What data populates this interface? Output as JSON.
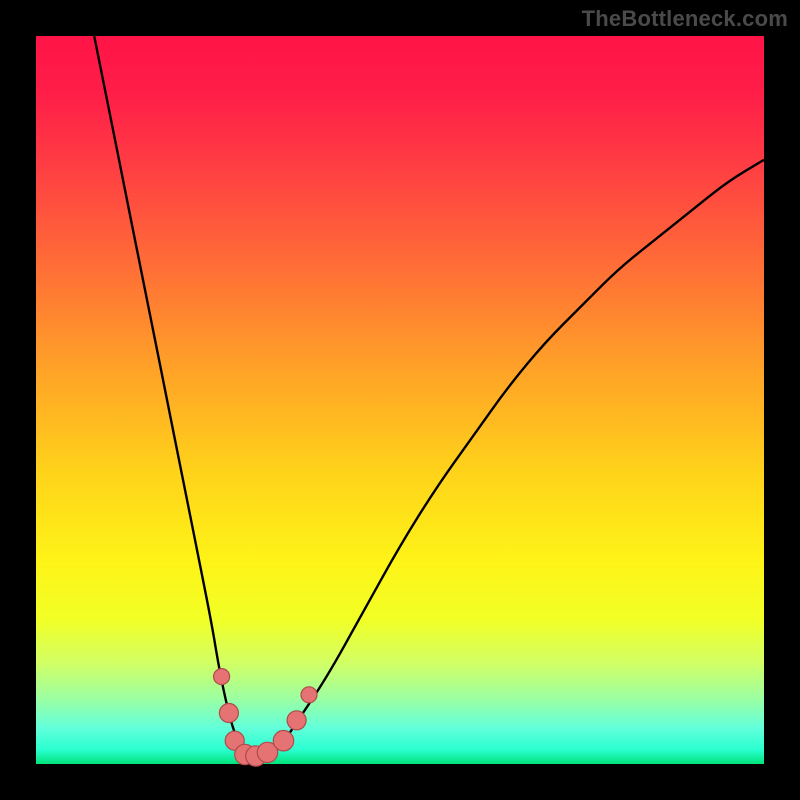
{
  "watermark": "TheBottleneck.com",
  "colors": {
    "frame": "#000000",
    "curve": "#000000",
    "marker_fill": "#e57373",
    "marker_stroke": "#b04a4a"
  },
  "chart_data": {
    "type": "line",
    "title": "",
    "xlabel": "",
    "ylabel": "",
    "xlim": [
      0,
      100
    ],
    "ylim": [
      0,
      100
    ],
    "grid": false,
    "legend": false,
    "series": [
      {
        "name": "bottleneck-curve",
        "x": [
          8,
          10,
          12,
          14,
          16,
          18,
          20,
          22,
          24,
          25,
          26,
          27,
          28,
          29,
          30,
          31,
          32,
          34,
          36,
          40,
          45,
          50,
          55,
          60,
          65,
          70,
          75,
          80,
          85,
          90,
          95,
          100
        ],
        "y": [
          100,
          90,
          80,
          70,
          60,
          50,
          40,
          30,
          20,
          14,
          9,
          5,
          2.5,
          1.5,
          1,
          1,
          1.5,
          3,
          6,
          12,
          21,
          30,
          38,
          45,
          52,
          58,
          63,
          68,
          72,
          76,
          80,
          83
        ]
      }
    ],
    "markers": [
      {
        "x": 25.5,
        "y": 12,
        "r": 1.1
      },
      {
        "x": 26.5,
        "y": 7,
        "r": 1.3
      },
      {
        "x": 27.3,
        "y": 3.2,
        "r": 1.3
      },
      {
        "x": 28.7,
        "y": 1.3,
        "r": 1.4
      },
      {
        "x": 30.2,
        "y": 1.1,
        "r": 1.4
      },
      {
        "x": 31.8,
        "y": 1.6,
        "r": 1.4
      },
      {
        "x": 34.0,
        "y": 3.2,
        "r": 1.4
      },
      {
        "x": 35.8,
        "y": 6.0,
        "r": 1.3
      },
      {
        "x": 37.5,
        "y": 9.5,
        "r": 1.1
      }
    ]
  }
}
